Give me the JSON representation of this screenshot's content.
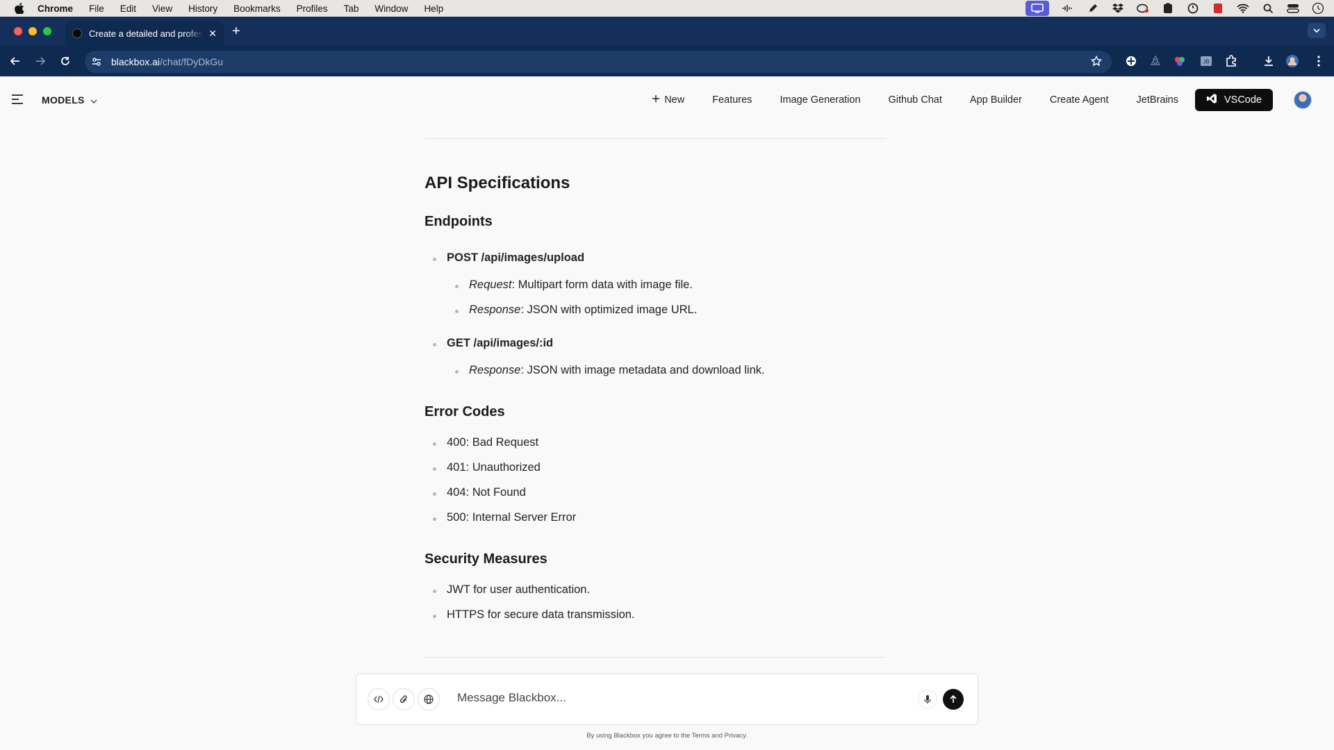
{
  "menubar": {
    "items": [
      "Chrome",
      "File",
      "Edit",
      "View",
      "History",
      "Bookmarks",
      "Profiles",
      "Tab",
      "Window",
      "Help"
    ]
  },
  "browser": {
    "tab_title": "Create a detailed and professional",
    "url_host": "blackbox.ai",
    "url_path": "/chat/fDyDkGu"
  },
  "header": {
    "models_label": "MODELS",
    "new_label": "New",
    "links": [
      "Features",
      "Image Generation",
      "Github Chat",
      "App Builder",
      "Create Agent",
      "JetBrains"
    ],
    "vscode_label": "VSCode"
  },
  "doc": {
    "api_title": "API Specifications",
    "endpoints_title": "Endpoints",
    "post_endpoint": "POST /api/images/upload",
    "post_request_label": "Request",
    "post_request_text": ": Multipart form data with image file.",
    "post_response_label": "Response",
    "post_response_text": ": JSON with optimized image URL.",
    "get_endpoint": "GET /api/images/:id",
    "get_response_label": "Response",
    "get_response_text": ": JSON with image metadata and download link.",
    "errors_title": "Error Codes",
    "errors": [
      "400: Bad Request",
      "401: Unauthorized",
      "404: Not Found",
      "500: Internal Server Error"
    ],
    "security_title": "Security Measures",
    "security": [
      "JWT for user authentication.",
      "HTTPS for secure data transmission."
    ]
  },
  "composer": {
    "placeholder": "Message Blackbox...",
    "legal": "By using Blackbox you agree to the Terms and Privacy."
  },
  "colors": {
    "tabstrip": "#14305a",
    "toolbar": "#0f2a50",
    "page_bg": "#f9f9f9",
    "accent_dark": "#0d0d0d"
  }
}
